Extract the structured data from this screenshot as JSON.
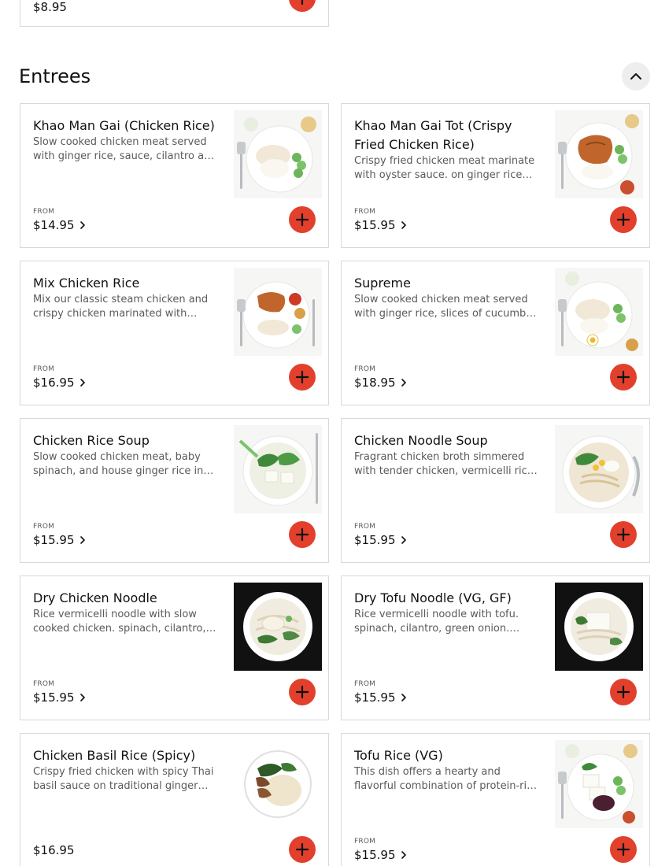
{
  "prev_item": {
    "price": "$8.95"
  },
  "section": {
    "title": "Entrees"
  },
  "from_label": "FROM",
  "accent_color": "#e2402c",
  "items": [
    {
      "title": "Khao Man Gai (Chicken Rice)",
      "description": "Slow cooked chicken meat served with ginger rice, sauce, cilantro and cucumber.",
      "price": "$14.95",
      "has_from": true
    },
    {
      "title": "Khao Man Gai Tot (Crispy Fried Chicken Rice)",
      "description": "Crispy fried chicken meat marinate with oyster sauce. on ginger rice served with sauce.",
      "price": "$15.95",
      "has_from": true
    },
    {
      "title": "Mix Chicken Rice",
      "description": "Mix our classic steam chicken and crispy chicken marinated with oyster sauce.",
      "price": "$16.95",
      "has_from": true
    },
    {
      "title": "Supreme",
      "description": "Slow cooked chicken meat served with ginger rice, slices of cucumber and a boiled egg.",
      "price": "$18.95",
      "has_from": true
    },
    {
      "title": "Chicken Rice Soup",
      "description": "Slow cooked chicken meat, baby spinach, and house ginger rice in broth.",
      "price": "$15.95",
      "has_from": true
    },
    {
      "title": "Chicken Noodle Soup",
      "description": "Fragrant chicken broth simmered with tender chicken, vermicelli rice noodle.",
      "price": "$15.95",
      "has_from": true
    },
    {
      "title": "Dry Chicken Noodle",
      "description": "Rice vermicelli noodle with slow cooked chicken. spinach, cilantro, green onion.",
      "price": "$15.95",
      "has_from": true
    },
    {
      "title": "Dry Tofu Noodle (VG, GF)",
      "description": "Rice vermicelli noodle with tofu. spinach, cilantro, green onion. Served dry.",
      "price": "$15.95",
      "has_from": true
    },
    {
      "title": "Chicken Basil Rice (Spicy)",
      "description": "Crispy fried chicken with spicy Thai basil sauce on traditional ginger rice.",
      "price": "$16.95",
      "has_from": false
    },
    {
      "title": "Tofu Rice (VG)",
      "description": "This dish offers a hearty and flavorful combination of protein-rich tofu.",
      "price": "$15.95",
      "has_from": true
    }
  ]
}
